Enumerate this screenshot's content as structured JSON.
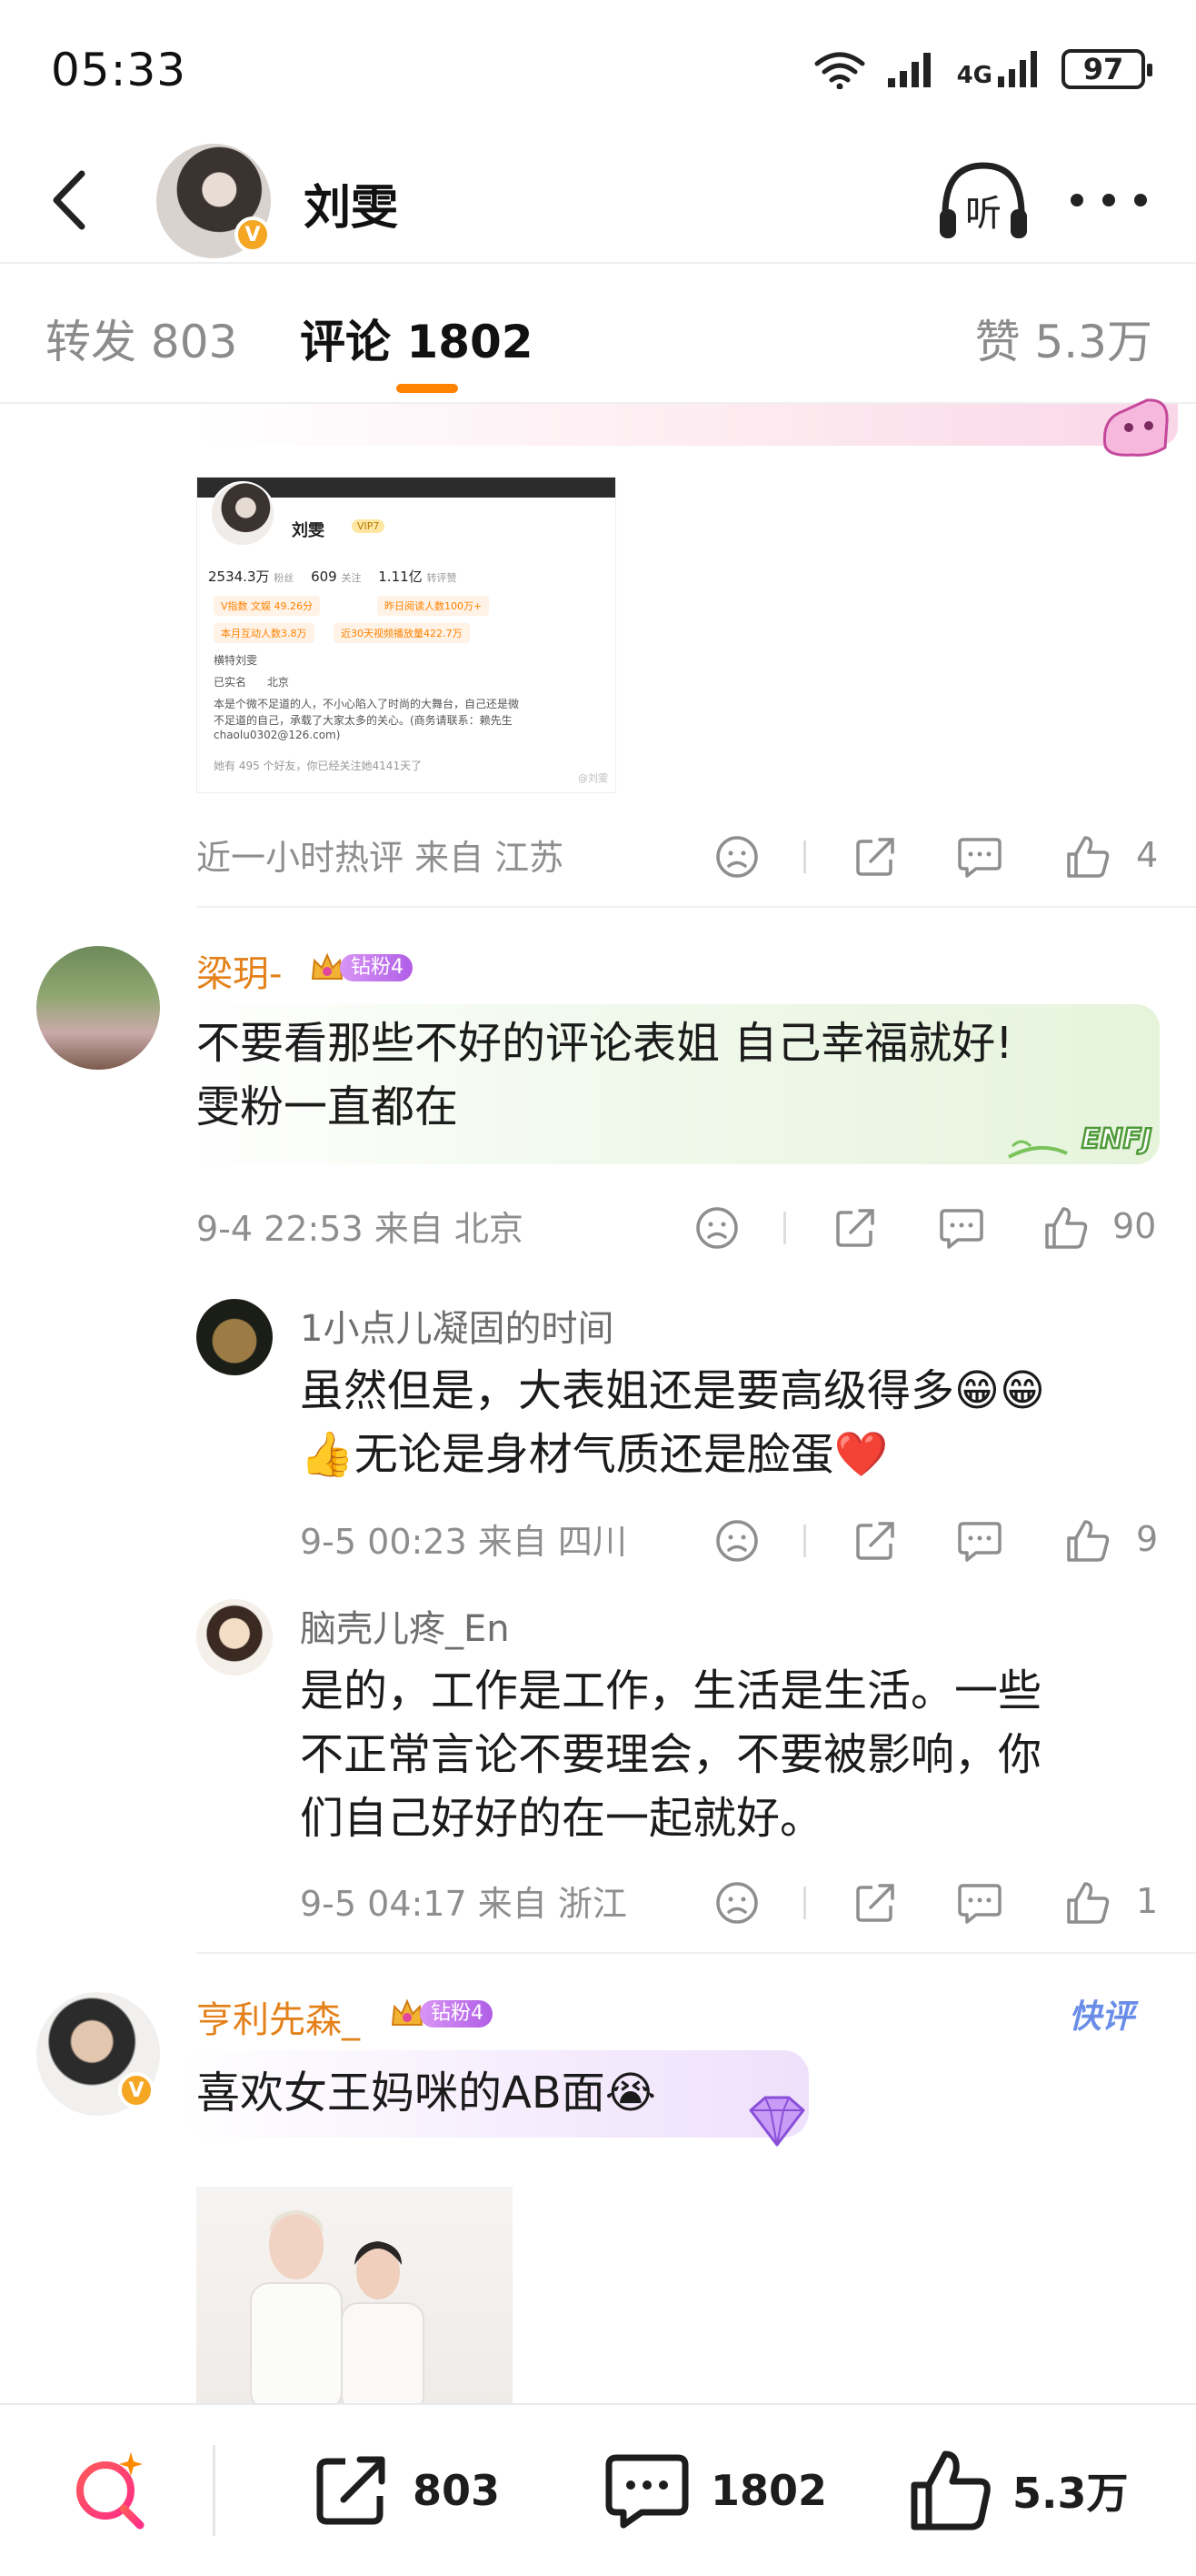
{
  "status_bar": {
    "time": "05:33",
    "network": "4G",
    "battery": "97"
  },
  "header": {
    "name": "刘雯",
    "listen_label": "听",
    "verified": "V"
  },
  "tabs": {
    "repost": "转发 803",
    "comment": "评论 1802",
    "like": "赞 5.3万"
  },
  "screenshot": {
    "name": "刘雯",
    "vip": "VIP7",
    "followers_value": "2534.3万",
    "followers_label": "粉丝",
    "following_value": "609",
    "following_label": "关注",
    "reposts_value": "1.11亿",
    "reposts_label": "转评赞",
    "pill_1": "V指数 文娱 49.26分",
    "pill_2": "昨日阅读人数100万+",
    "pill_3": "本月互动人数3.8万",
    "pill_4": "近30天视频播放量422.7万",
    "line_1": "横特刘雯",
    "line_2": "已实名",
    "line_3": "北京",
    "line_4": "本是个微不足道的人，不小心陷入了时尚的大舞台，自己还是微",
    "line_5": "不足道的自己，承载了大家太多的关心。(商务请联系：赖先生",
    "line_6": "chaolu0302@126.com)",
    "line_7": "她有 495 个好友，你已经关注她4141天了",
    "watermark": "@刘雯"
  },
  "comment_0": {
    "meta": "近一小时热评  来自 江苏",
    "likes": "4"
  },
  "comment_1": {
    "username": "梁玥-",
    "fan_badge": "钻粉4",
    "text_line1": "不要看那些不好的评论表姐 自己幸福就好!",
    "text_line2": "雯粉一直都在",
    "sticker": "ENFJ",
    "meta": "9-4 22:53  来自 北京",
    "likes": "90"
  },
  "reply_1": {
    "username": "1小点儿凝固的时间",
    "text_line1": "虽然但是，大表姐还是要高级得多😁😁",
    "text_line2": "👍无论是身材气质还是脸蛋❤️",
    "meta": "9-5 00:23  来自 四川",
    "likes": "9"
  },
  "reply_2": {
    "username": "脑壳儿疼_En",
    "text_line1": "是的，工作是工作，生活是生活。一些",
    "text_line2": "不正常言论不要理会，不要被影响，你",
    "text_line3": "们自己好好的在一起就好。",
    "meta": "9-5 04:17  来自 浙江",
    "likes": "1"
  },
  "comment_2": {
    "username": "亨利先森_",
    "fan_badge": "钻粉4",
    "tag": "快评",
    "text": "喜欢女王妈咪的AB面😭"
  },
  "bottom_bar": {
    "reposts": "803",
    "comments": "1802",
    "likes": "5.3万"
  },
  "colors": {
    "accent": "#ff8200",
    "username": "#e4811a",
    "muted": "#8e8e8e",
    "fan_badge": "#b05ee6"
  }
}
